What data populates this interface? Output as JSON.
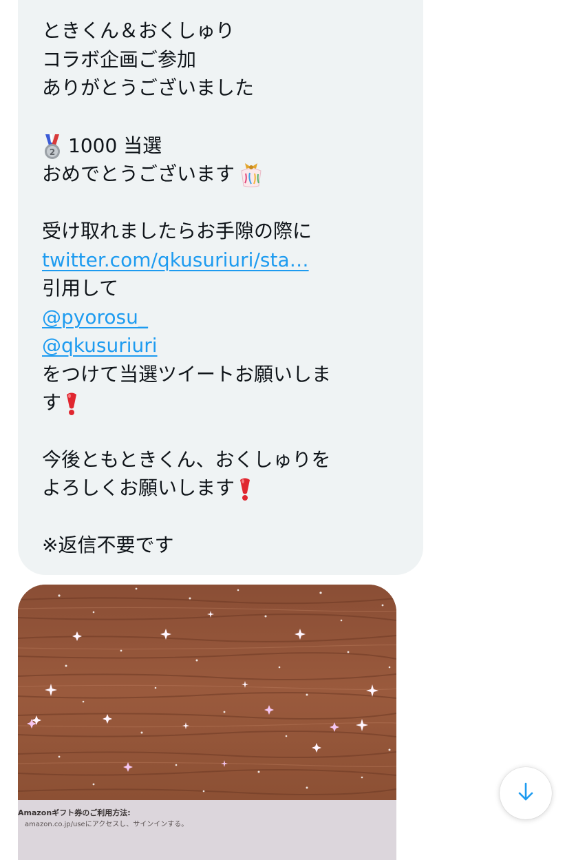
{
  "message": {
    "lines": [
      "ときくん＆おくしゅり",
      "コラボ企画ご参加",
      "ありがとうございました",
      "1000 当選",
      "おめでとうございます",
      "受け取れましたらお手隙の際に",
      "twitter.com/qkusuriuri/sta…",
      "引用して",
      "@pyorosu_",
      "@qkusuriuri",
      "をつけて当選ツイートお願いしま",
      "す",
      "今後ともときくん、おくしゅりを",
      "よろしくお願いします",
      "※返信不要です"
    ]
  },
  "icons": {
    "medal": "second-place-medal-icon",
    "party": "confetti-ball-icon",
    "exclamation": "red-exclamation-icon",
    "scroll": "arrow-down-icon"
  },
  "photo": {
    "card_title": "Amazonギフト券のご利用方法:",
    "card_sub": "amazon.co.jp/useにアクセスし、サインインする。"
  },
  "colors": {
    "bubble": "#eff3f4",
    "text": "#0f1419",
    "link": "#1d9bf0"
  }
}
